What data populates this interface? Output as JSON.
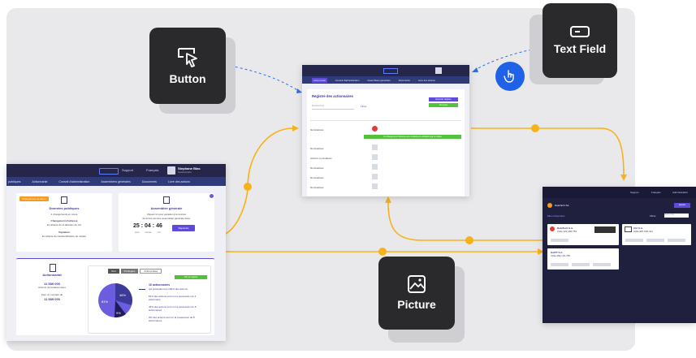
{
  "badges": {
    "button": {
      "label": "Button",
      "icon": "cursor-click-icon"
    },
    "text_field": {
      "label": "Text Field",
      "icon": "text-field-icon"
    },
    "picture": {
      "label": "Picture",
      "icon": "image-icon"
    }
  },
  "colors": {
    "canvas": "#e9e9eb",
    "badge_bg": "#2a2a2c",
    "flow_line": "#f7b21a",
    "dashed_link": "#2f6fe0",
    "hand_circle": "#1f62e8",
    "nav_dark": "#26264a",
    "nav_mid": "#2f3a78",
    "accent_purple": "#5e4bd8",
    "accent_green": "#52c23a"
  },
  "left_screen": {
    "topbar": {
      "support": "Support",
      "lang": "Français",
      "user": "Stephane Blas",
      "user_sub": "Gestionnaire"
    },
    "tabs": [
      "publiques",
      "Actionnariat",
      "Conseil d'administration",
      "Assemblées générales",
      "Documents",
      "Livre des actions"
    ],
    "panel_left": {
      "tag": "Changement de statut",
      "title": "Données publiques",
      "line1": "1 changements en cours",
      "line2": "Changement d'adresse",
      "line3": "En attente de la décision du CA",
      "line4": "Signature",
      "line5": "En attente de l'authentification de notaire"
    },
    "panel_right": {
      "title": "Assemblée générale",
      "line1": "Cliquez ici pour accéder à la réunion",
      "line2": "de Accès Homme assemblée générale dans:",
      "countdown": [
        "25",
        "04",
        "46"
      ],
      "units": [
        "jours",
        "heures",
        "min"
      ],
      "button": "Rejoindre"
    },
    "shareholding": {
      "title": "Actionnariat",
      "value": "11 589 000",
      "sub": "Actions nominatives liées",
      "line2": "Pour un montant de",
      "amount": "11 589 000",
      "filters": [
        "Tout",
        "Privilégiés",
        "Actions liées"
      ],
      "bar": "Voir le registre",
      "stat_big": "16 actionnaires",
      "stat_big_sub": "qui possèdent les 100% des actions",
      "stats": [
        "81% des actions sont en la possession de 1 actionnaire",
        "46% des actions sont en la possession de 8 actionnaires",
        "9% des actions sont en la possession de 8 actionnaires"
      ],
      "pie_labels": [
        "46%",
        "81%",
        "9%"
      ]
    }
  },
  "center_screen": {
    "title": "Registre des actionnaires",
    "search_placeholder": "Rechercher",
    "filter": "Filtrer",
    "button1": "Exporter registre",
    "button2": "Nouveau",
    "tabs": [
      "Actionnariat",
      "Conseil d'administration",
      "Assemblées générales",
      "Documents",
      "Livre des actions"
    ],
    "notice": "Un changement d'adresse est en attente de validation par le notaire",
    "rows": [
      "Nominatives",
      "Nominatives",
      "Actions nominatives",
      "Nominatives",
      "Nominatives",
      "Nominatives",
      "Nominatives",
      "Nominatives"
    ]
  },
  "right_screen": {
    "topbar": {
      "support": "Support",
      "lang": "Français",
      "user": "Administration"
    },
    "notice": "DataTech SA",
    "tab": "Mes entreprises",
    "filter": "Filtrer",
    "search_placeholder": "Rechercher",
    "button": "Ajouter",
    "cards": [
      {
        "name": "DataTech S.A.",
        "sub": "CHE-123.456.789"
      },
      {
        "name": "Ctrl S.A.",
        "sub": "CHE-987.654.321"
      },
      {
        "name": "HatTP S.A.",
        "sub": "CHE-456.123.789"
      }
    ]
  }
}
